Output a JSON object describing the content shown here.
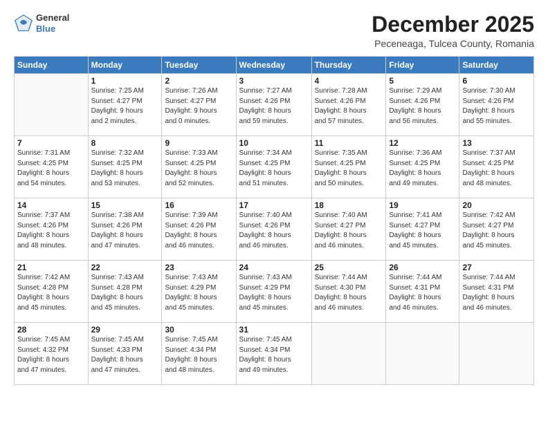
{
  "header": {
    "logo_general": "General",
    "logo_blue": "Blue",
    "month_title": "December 2025",
    "location": "Peceneaga, Tulcea County, Romania"
  },
  "days_of_week": [
    "Sunday",
    "Monday",
    "Tuesday",
    "Wednesday",
    "Thursday",
    "Friday",
    "Saturday"
  ],
  "weeks": [
    [
      {
        "day": "",
        "sunrise": "",
        "sunset": "",
        "daylight": ""
      },
      {
        "day": "1",
        "sunrise": "Sunrise: 7:25 AM",
        "sunset": "Sunset: 4:27 PM",
        "daylight": "Daylight: 9 hours and 2 minutes."
      },
      {
        "day": "2",
        "sunrise": "Sunrise: 7:26 AM",
        "sunset": "Sunset: 4:27 PM",
        "daylight": "Daylight: 9 hours and 0 minutes."
      },
      {
        "day": "3",
        "sunrise": "Sunrise: 7:27 AM",
        "sunset": "Sunset: 4:26 PM",
        "daylight": "Daylight: 8 hours and 59 minutes."
      },
      {
        "day": "4",
        "sunrise": "Sunrise: 7:28 AM",
        "sunset": "Sunset: 4:26 PM",
        "daylight": "Daylight: 8 hours and 57 minutes."
      },
      {
        "day": "5",
        "sunrise": "Sunrise: 7:29 AM",
        "sunset": "Sunset: 4:26 PM",
        "daylight": "Daylight: 8 hours and 56 minutes."
      },
      {
        "day": "6",
        "sunrise": "Sunrise: 7:30 AM",
        "sunset": "Sunset: 4:26 PM",
        "daylight": "Daylight: 8 hours and 55 minutes."
      }
    ],
    [
      {
        "day": "7",
        "sunrise": "Sunrise: 7:31 AM",
        "sunset": "Sunset: 4:25 PM",
        "daylight": "Daylight: 8 hours and 54 minutes."
      },
      {
        "day": "8",
        "sunrise": "Sunrise: 7:32 AM",
        "sunset": "Sunset: 4:25 PM",
        "daylight": "Daylight: 8 hours and 53 minutes."
      },
      {
        "day": "9",
        "sunrise": "Sunrise: 7:33 AM",
        "sunset": "Sunset: 4:25 PM",
        "daylight": "Daylight: 8 hours and 52 minutes."
      },
      {
        "day": "10",
        "sunrise": "Sunrise: 7:34 AM",
        "sunset": "Sunset: 4:25 PM",
        "daylight": "Daylight: 8 hours and 51 minutes."
      },
      {
        "day": "11",
        "sunrise": "Sunrise: 7:35 AM",
        "sunset": "Sunset: 4:25 PM",
        "daylight": "Daylight: 8 hours and 50 minutes."
      },
      {
        "day": "12",
        "sunrise": "Sunrise: 7:36 AM",
        "sunset": "Sunset: 4:25 PM",
        "daylight": "Daylight: 8 hours and 49 minutes."
      },
      {
        "day": "13",
        "sunrise": "Sunrise: 7:37 AM",
        "sunset": "Sunset: 4:25 PM",
        "daylight": "Daylight: 8 hours and 48 minutes."
      }
    ],
    [
      {
        "day": "14",
        "sunrise": "Sunrise: 7:37 AM",
        "sunset": "Sunset: 4:26 PM",
        "daylight": "Daylight: 8 hours and 48 minutes."
      },
      {
        "day": "15",
        "sunrise": "Sunrise: 7:38 AM",
        "sunset": "Sunset: 4:26 PM",
        "daylight": "Daylight: 8 hours and 47 minutes."
      },
      {
        "day": "16",
        "sunrise": "Sunrise: 7:39 AM",
        "sunset": "Sunset: 4:26 PM",
        "daylight": "Daylight: 8 hours and 46 minutes."
      },
      {
        "day": "17",
        "sunrise": "Sunrise: 7:40 AM",
        "sunset": "Sunset: 4:26 PM",
        "daylight": "Daylight: 8 hours and 46 minutes."
      },
      {
        "day": "18",
        "sunrise": "Sunrise: 7:40 AM",
        "sunset": "Sunset: 4:27 PM",
        "daylight": "Daylight: 8 hours and 46 minutes."
      },
      {
        "day": "19",
        "sunrise": "Sunrise: 7:41 AM",
        "sunset": "Sunset: 4:27 PM",
        "daylight": "Daylight: 8 hours and 45 minutes."
      },
      {
        "day": "20",
        "sunrise": "Sunrise: 7:42 AM",
        "sunset": "Sunset: 4:27 PM",
        "daylight": "Daylight: 8 hours and 45 minutes."
      }
    ],
    [
      {
        "day": "21",
        "sunrise": "Sunrise: 7:42 AM",
        "sunset": "Sunset: 4:28 PM",
        "daylight": "Daylight: 8 hours and 45 minutes."
      },
      {
        "day": "22",
        "sunrise": "Sunrise: 7:43 AM",
        "sunset": "Sunset: 4:28 PM",
        "daylight": "Daylight: 8 hours and 45 minutes."
      },
      {
        "day": "23",
        "sunrise": "Sunrise: 7:43 AM",
        "sunset": "Sunset: 4:29 PM",
        "daylight": "Daylight: 8 hours and 45 minutes."
      },
      {
        "day": "24",
        "sunrise": "Sunrise: 7:43 AM",
        "sunset": "Sunset: 4:29 PM",
        "daylight": "Daylight: 8 hours and 45 minutes."
      },
      {
        "day": "25",
        "sunrise": "Sunrise: 7:44 AM",
        "sunset": "Sunset: 4:30 PM",
        "daylight": "Daylight: 8 hours and 46 minutes."
      },
      {
        "day": "26",
        "sunrise": "Sunrise: 7:44 AM",
        "sunset": "Sunset: 4:31 PM",
        "daylight": "Daylight: 8 hours and 46 minutes."
      },
      {
        "day": "27",
        "sunrise": "Sunrise: 7:44 AM",
        "sunset": "Sunset: 4:31 PM",
        "daylight": "Daylight: 8 hours and 46 minutes."
      }
    ],
    [
      {
        "day": "28",
        "sunrise": "Sunrise: 7:45 AM",
        "sunset": "Sunset: 4:32 PM",
        "daylight": "Daylight: 8 hours and 47 minutes."
      },
      {
        "day": "29",
        "sunrise": "Sunrise: 7:45 AM",
        "sunset": "Sunset: 4:33 PM",
        "daylight": "Daylight: 8 hours and 47 minutes."
      },
      {
        "day": "30",
        "sunrise": "Sunrise: 7:45 AM",
        "sunset": "Sunset: 4:34 PM",
        "daylight": "Daylight: 8 hours and 48 minutes."
      },
      {
        "day": "31",
        "sunrise": "Sunrise: 7:45 AM",
        "sunset": "Sunset: 4:34 PM",
        "daylight": "Daylight: 8 hours and 49 minutes."
      },
      {
        "day": "",
        "sunrise": "",
        "sunset": "",
        "daylight": ""
      },
      {
        "day": "",
        "sunrise": "",
        "sunset": "",
        "daylight": ""
      },
      {
        "day": "",
        "sunrise": "",
        "sunset": "",
        "daylight": ""
      }
    ]
  ]
}
